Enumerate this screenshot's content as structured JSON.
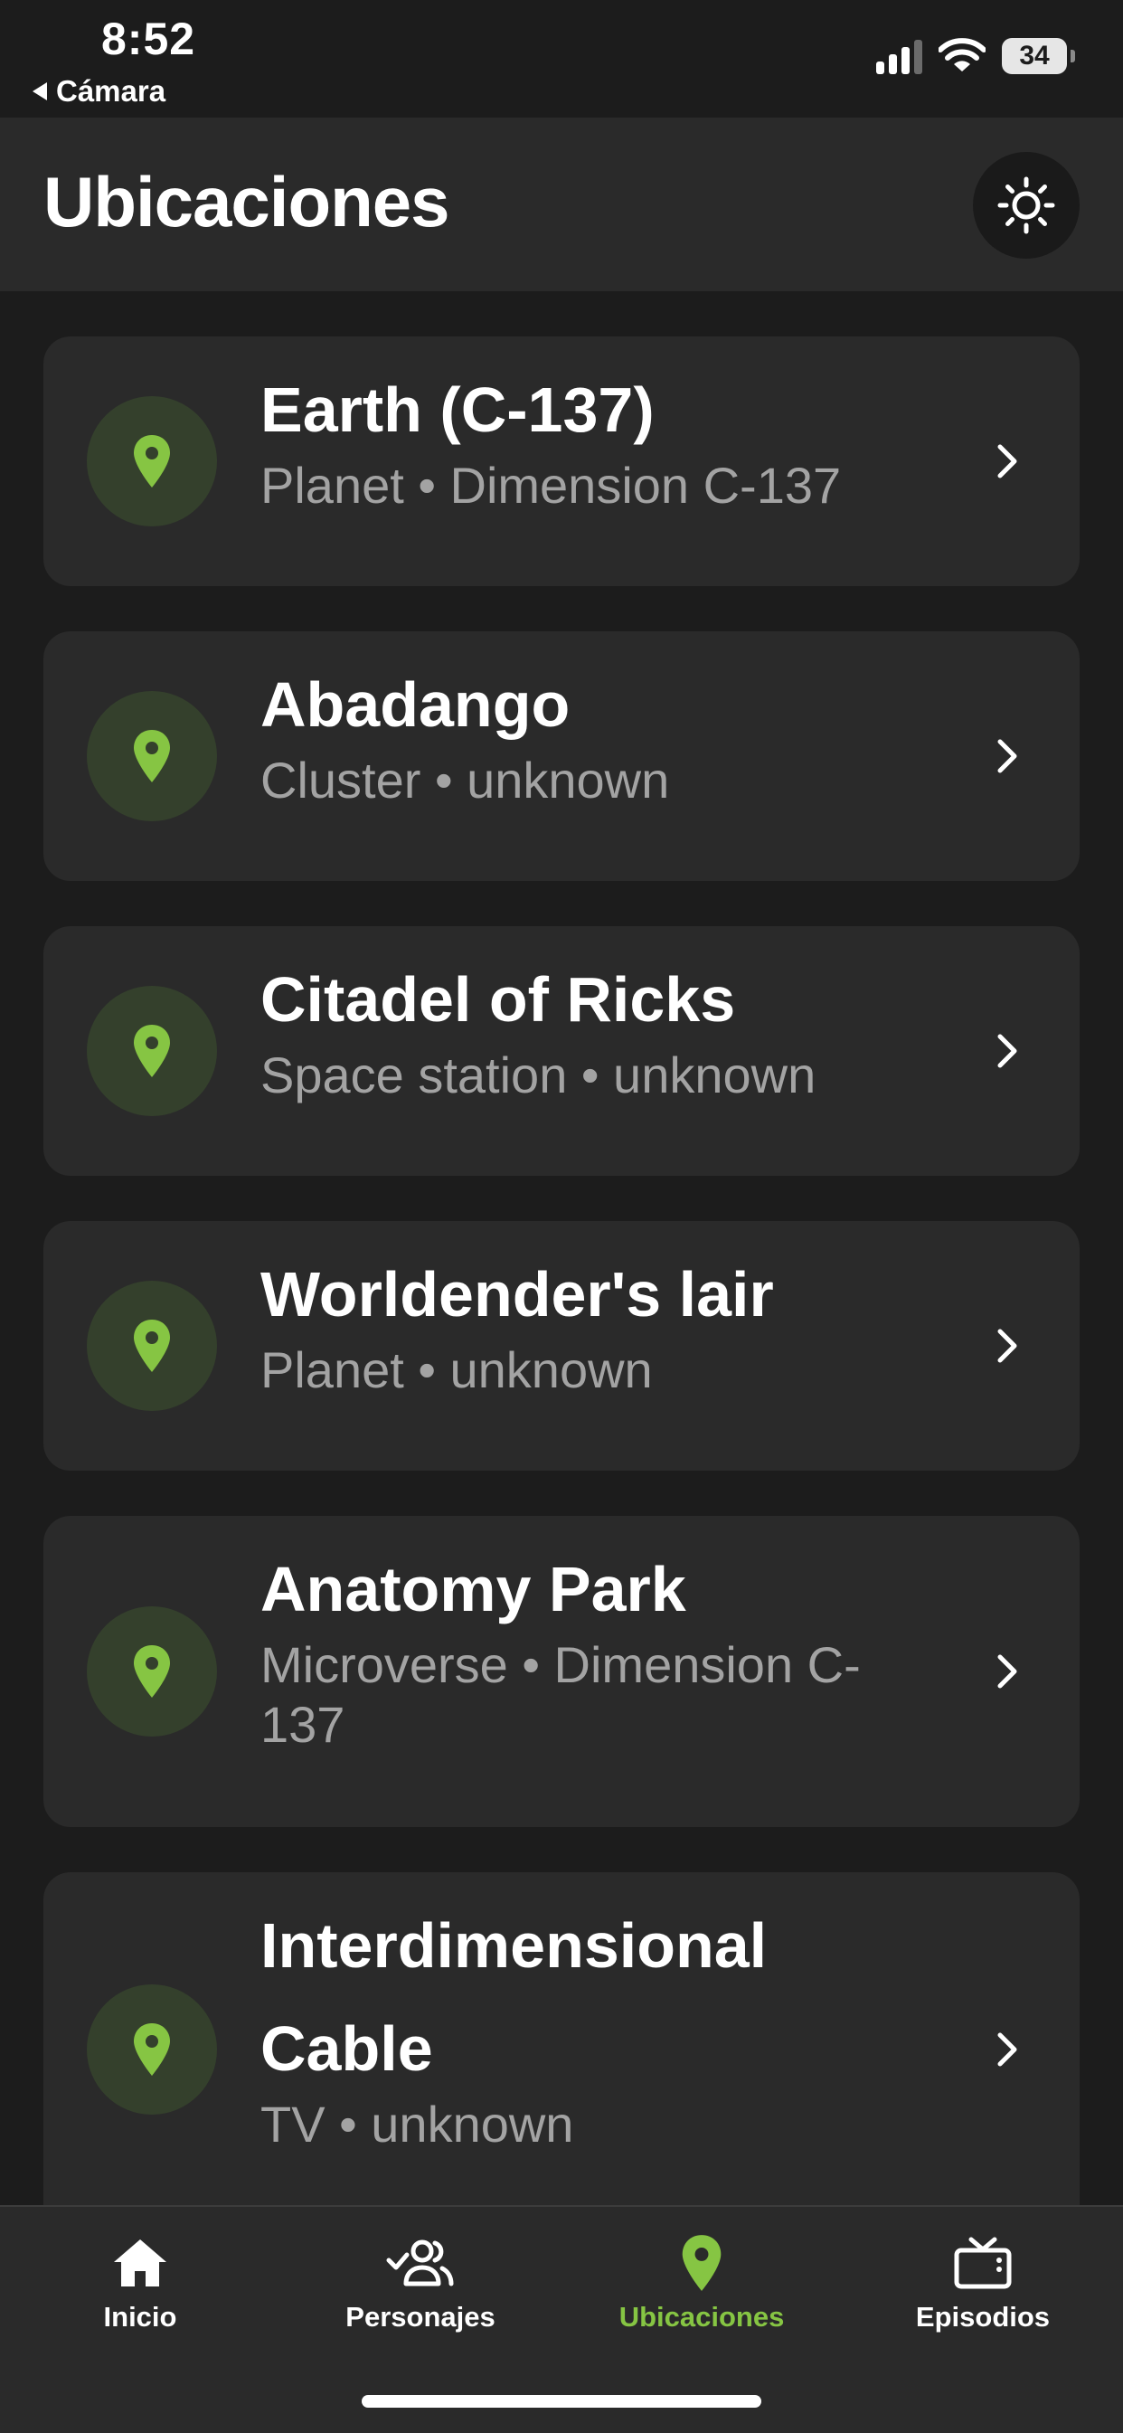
{
  "status_bar": {
    "time": "8:52",
    "back_label": "Cámara",
    "battery": "34"
  },
  "header": {
    "title": "Ubicaciones",
    "theme_icon": "sun-icon"
  },
  "locations": [
    {
      "name": "Earth (C-137)",
      "type": "Planet",
      "dimension": "Dimension C-137",
      "subtitle": "Planet • Dimension C-137"
    },
    {
      "name": "Abadango",
      "type": "Cluster",
      "dimension": "unknown",
      "subtitle": "Cluster • unknown"
    },
    {
      "name": "Citadel of Ricks",
      "type": "Space station",
      "dimension": "unknown",
      "subtitle": "Space station • unknown"
    },
    {
      "name": "Worldender's lair",
      "type": "Planet",
      "dimension": "unknown",
      "subtitle": "Planet • unknown"
    },
    {
      "name": "Anatomy Park",
      "type": "Microverse",
      "dimension": "Dimension C-137",
      "subtitle": "Microverse • Dimension C-137"
    },
    {
      "name": "Interdimensional Cable",
      "type": "TV",
      "dimension": "unknown",
      "subtitle": "TV • unknown"
    }
  ],
  "nav": [
    {
      "label": "Inicio",
      "icon": "home-icon",
      "active": false
    },
    {
      "label": "Personajes",
      "icon": "people-icon",
      "active": false
    },
    {
      "label": "Ubicaciones",
      "icon": "location-pin-icon",
      "active": true
    },
    {
      "label": "Episodios",
      "icon": "tv-icon",
      "active": false
    }
  ],
  "colors": {
    "background": "#1c1c1c",
    "surface": "#2a2a2a",
    "accent": "#86c543",
    "pin_circle": "#34402c",
    "secondary_text": "#a3a3a3"
  }
}
